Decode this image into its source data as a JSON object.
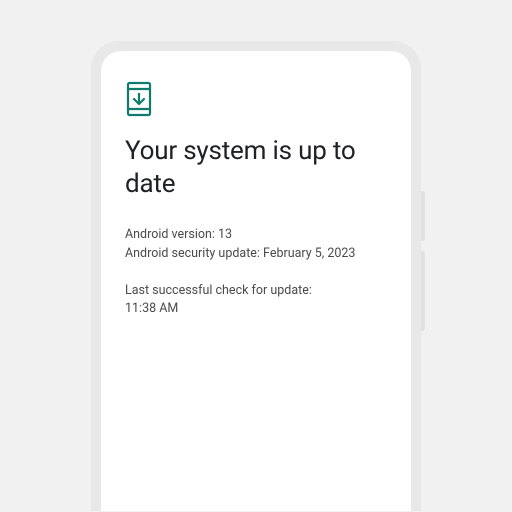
{
  "icon_color": "#0f7b6c",
  "title": "Your system is up to date",
  "version_info": {
    "android_version_label": "Android version: 13",
    "security_update_label": "Android security update: February 5, 2023"
  },
  "check_info": {
    "last_check_label": "Last successful check for update:",
    "last_check_time": "11:38 AM"
  }
}
